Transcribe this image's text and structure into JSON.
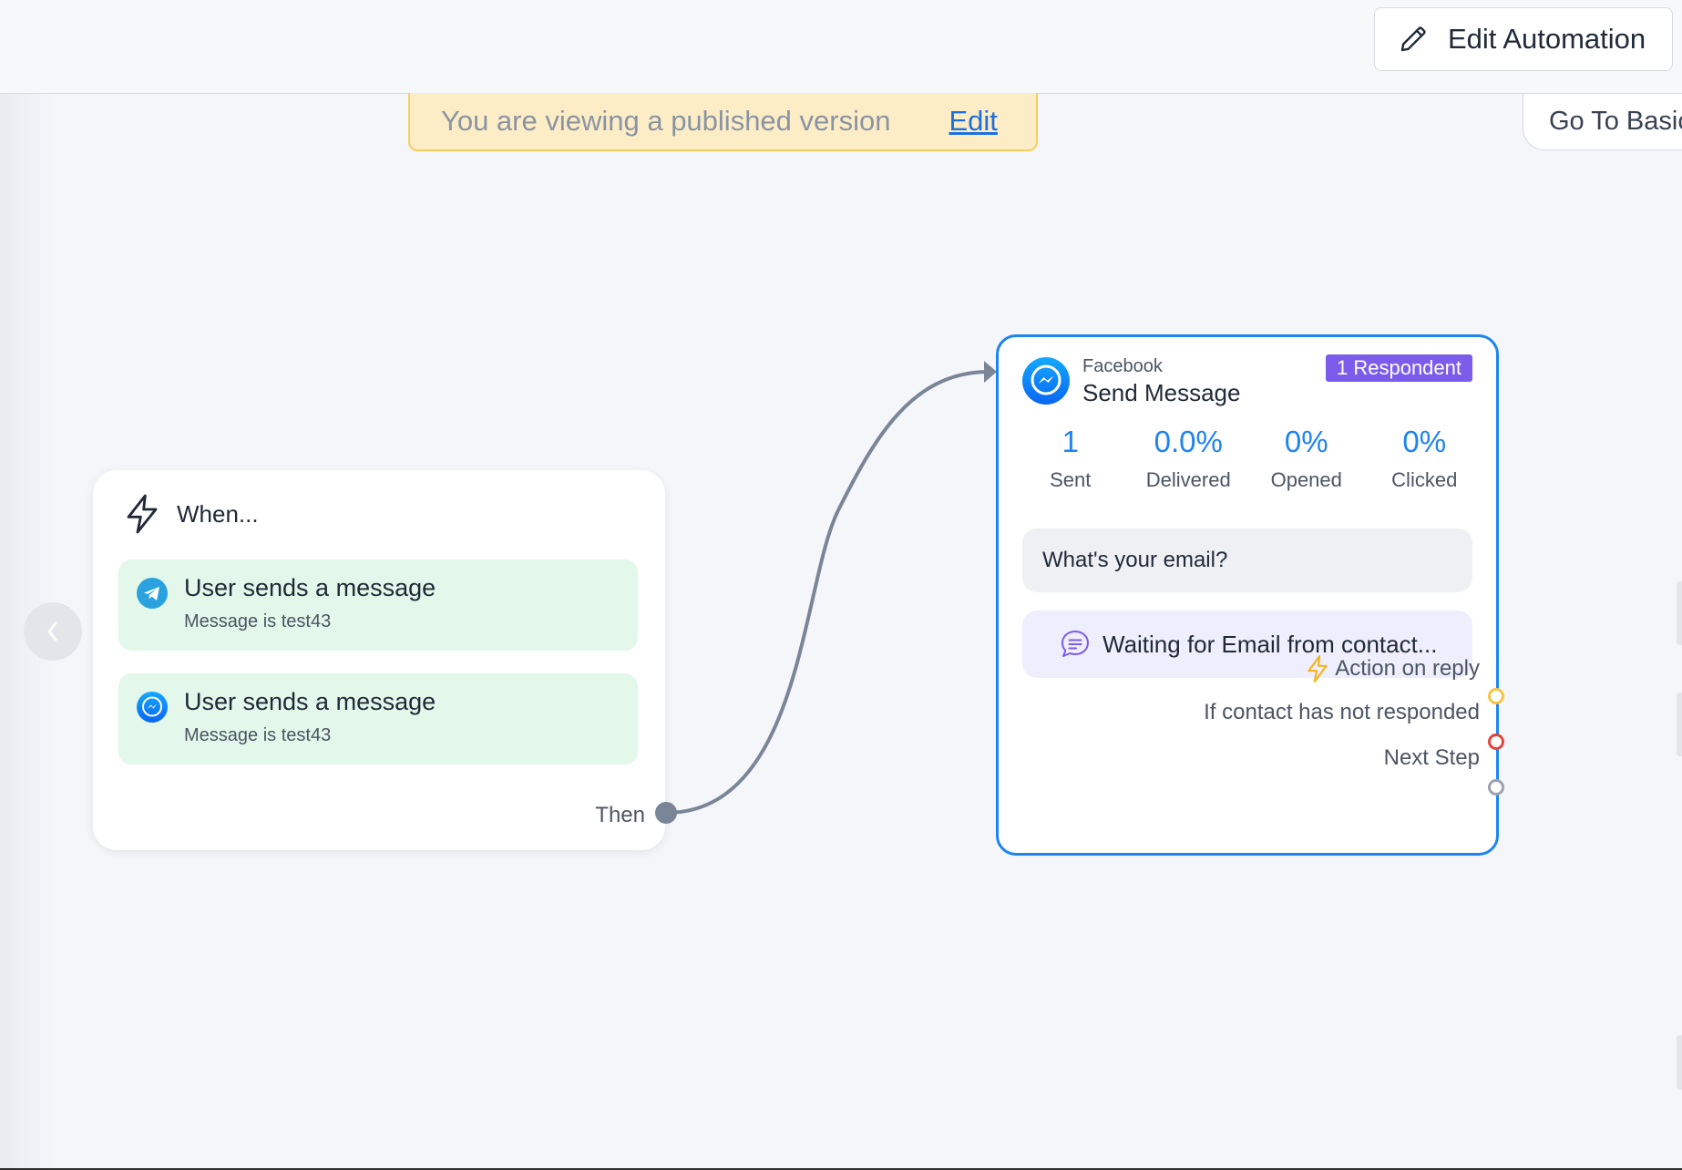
{
  "header": {
    "edit_automation_label": "Edit Automation",
    "pencil_icon": "pencil-icon"
  },
  "banner": {
    "text": "You are viewing a published version",
    "edit_link": "Edit",
    "background": "#fdedc7",
    "border": "#f6cf5d"
  },
  "side_panel": {
    "go_to_basic_label": "Go To Basic"
  },
  "trigger": {
    "heading": "When...",
    "icon": "lightning-bolt-icon",
    "items": [
      {
        "channel": "telegram",
        "icon": "telegram-icon",
        "title": "User sends a message",
        "subtitle": "Message is test43"
      },
      {
        "channel": "facebook-messenger",
        "icon": "messenger-icon",
        "title": "User sends a message",
        "subtitle": "Message is test43"
      }
    ],
    "then_label": "Then"
  },
  "send_message": {
    "platform": "Facebook",
    "title": "Send Message",
    "icon": "messenger-icon",
    "respondent_badge": "1 Respondent",
    "stats": [
      {
        "value": "1",
        "label": "Sent"
      },
      {
        "value": "0.0%",
        "label": "Delivered"
      },
      {
        "value": "0%",
        "label": "Opened"
      },
      {
        "value": "0%",
        "label": "Clicked"
      }
    ],
    "question": "What's your email?",
    "waiting_text": "Waiting for Email from contact...",
    "branches": [
      {
        "label": "Action on reply",
        "color": "#f5c542"
      },
      {
        "label": "If contact has not responded",
        "color": "#e0463a"
      },
      {
        "label": "Next Step",
        "color": "#9aa1ad"
      }
    ]
  },
  "colors": {
    "accent_blue": "#1d84f0",
    "respondent_purple": "#7b5ceb",
    "trigger_item_bg": "#e3f8ea",
    "connector": "#7b8598"
  }
}
